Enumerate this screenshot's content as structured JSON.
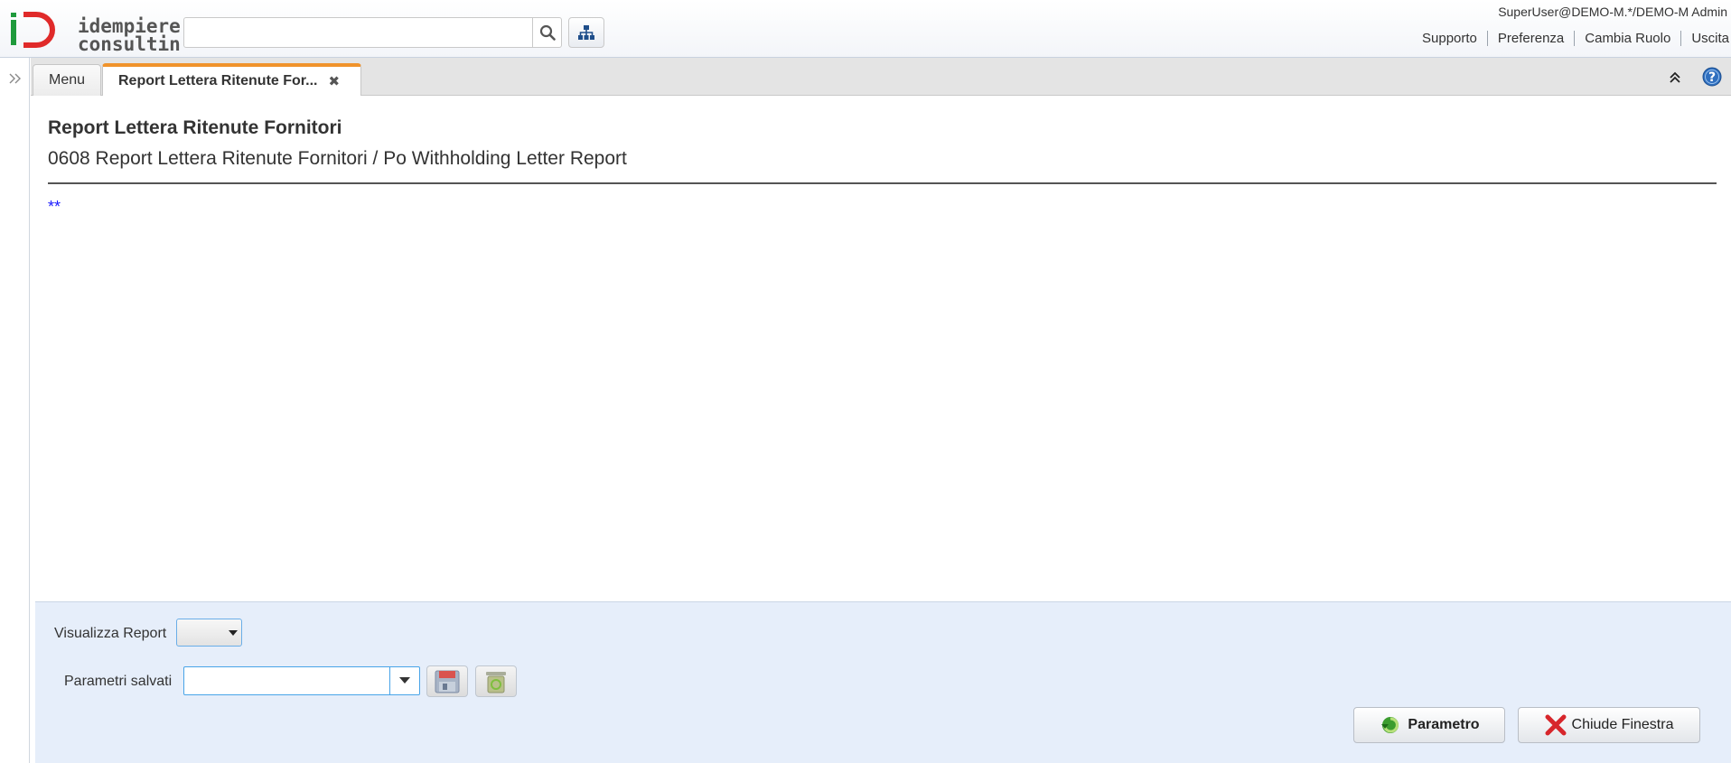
{
  "header": {
    "logo_text_line1": "idempiere",
    "logo_text_line2": "consulting",
    "search": {
      "value": "",
      "placeholder": ""
    },
    "user_info": "SuperUser@DEMO-M.*/DEMO-M Admin",
    "links": [
      {
        "label": "Supporto"
      },
      {
        "label": "Preferenza"
      },
      {
        "label": "Cambia Ruolo"
      },
      {
        "label": "Uscita"
      }
    ]
  },
  "tabs": [
    {
      "label": "Menu",
      "active": false
    },
    {
      "label": "Report Lettera Ritenute For...",
      "active": true,
      "close": "✖"
    }
  ],
  "process": {
    "title": "Report Lettera Ritenute Fornitori",
    "description": "0608 Report Lettera Ritenute Fornitori / Po Withholding Letter Report",
    "help": "**"
  },
  "params": {
    "report_label": "Visualizza Report",
    "report_value": "",
    "saved_label": "Parametri salvati",
    "saved_value": "",
    "param_button": "Parametro",
    "close_button": "Chiude Finestra"
  },
  "colors": {
    "accent_tab": "#f0932b",
    "panel_bg": "#e6eefa",
    "help_text": "#1a1aff",
    "logo_green": "#1f9a3c",
    "logo_red": "#e02a2a"
  },
  "icons": [
    "search-icon",
    "sitemap-icon",
    "expand-icon",
    "collapse-icon",
    "help-icon",
    "save-icon",
    "delete-icon",
    "process-icon",
    "close-icon"
  ]
}
